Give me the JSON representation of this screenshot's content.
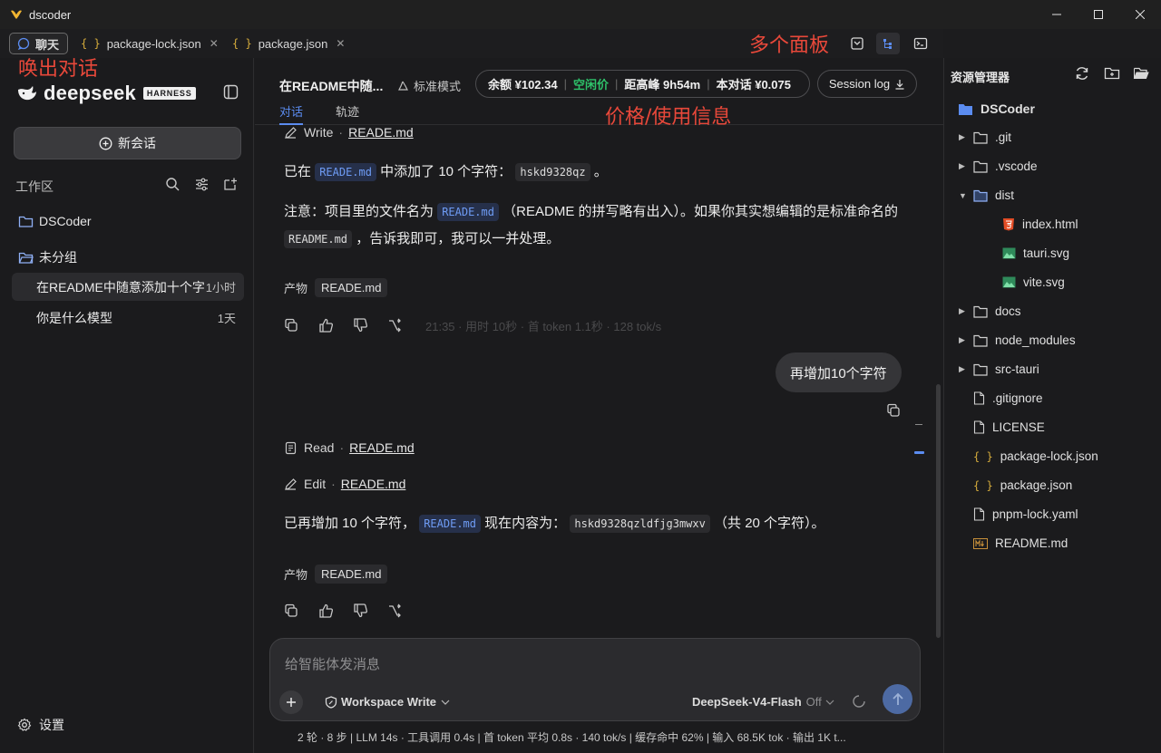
{
  "window": {
    "title": "dscoder"
  },
  "tabs": [
    {
      "label": "聊天"
    },
    {
      "label": "package-lock.json"
    },
    {
      "label": "package.json"
    }
  ],
  "annotations": {
    "summon_chat": "唤出对话",
    "multi_panel": "多个面板",
    "price_info": "价格/使用信息"
  },
  "sidebar": {
    "brand": "deepseek",
    "brand_badge": "HARNESS",
    "new_chat": "新会话",
    "workspace_label": "工作区",
    "groups": [
      {
        "label": "DSCoder"
      },
      {
        "label": "未分组"
      }
    ],
    "chats": [
      {
        "title": "在README中随意添加十个字",
        "time": "1小时"
      },
      {
        "title": "你是什么模型",
        "time": "1天"
      }
    ],
    "settings": "设置"
  },
  "header": {
    "title": "在README中随...",
    "mode": "标准模式",
    "price": {
      "balance": "余额 ¥102.34",
      "tier": "空闲价",
      "peak": "距高峰 9h54m",
      "conversation": "本对话 ¥0.075"
    },
    "session_log": "Session log",
    "tabs": {
      "chat": "对话",
      "track": "轨迹"
    }
  },
  "messages": {
    "m1": {
      "tool": {
        "action": "Write",
        "file": "READE.md"
      },
      "p1": {
        "a": "已在",
        "code1": "READE.md",
        "b": "中添加了 10 个字符：",
        "code2": "hskd9328qz",
        "c": "。"
      },
      "p2": {
        "a": "注意：项目里的文件名为",
        "code1": "READE.md",
        "b": "（README 的拼写略有出入）。如果你其实想编辑的是标准命名的",
        "code2": "README.md",
        "c": "，告诉我即可，我可以一并处理。"
      },
      "artifact_label": "产物",
      "artifact": "READE.md",
      "stats": "21:35  ·  用时 10秒  ·  首 token 1.1秒  ·  128 tok/s"
    },
    "user": "再增加10个字符",
    "m2": {
      "read": {
        "action": "Read",
        "file": "READE.md"
      },
      "edit": {
        "action": "Edit",
        "file": "READE.md"
      },
      "p1": {
        "a": "已再增加 10 个字符，",
        "code1": "READE.md",
        "b": "现在内容为：",
        "code2": "hskd9328qzldfjg3mwxv",
        "c": "（共 20 个字符）。"
      },
      "artifact_label": "产物",
      "artifact": "READE.md"
    }
  },
  "composer": {
    "placeholder": "给智能体发消息",
    "workspace_mode": "Workspace Write",
    "model": "DeepSeek-V4-Flash",
    "model_toggle": "Off"
  },
  "statusline": "2 轮 · 8 步   |   LLM 14s · 工具调用 0.4s   |   首 token 平均 0.8s · 140 tok/s   |   缓存命中 62%   |   输入 68.5K tok · 输出 1K t...",
  "explorer": {
    "title": "资源管理器",
    "root": "DSCoder",
    "items": [
      {
        "name": ".git",
        "kind": "folder"
      },
      {
        "name": ".vscode",
        "kind": "folder"
      },
      {
        "name": "dist",
        "kind": "folder-open"
      },
      {
        "name": "index.html",
        "kind": "html"
      },
      {
        "name": "tauri.svg",
        "kind": "image"
      },
      {
        "name": "vite.svg",
        "kind": "image"
      },
      {
        "name": "docs",
        "kind": "folder"
      },
      {
        "name": "node_modules",
        "kind": "folder"
      },
      {
        "name": "src-tauri",
        "kind": "folder"
      },
      {
        "name": ".gitignore",
        "kind": "file"
      },
      {
        "name": "LICENSE",
        "kind": "file"
      },
      {
        "name": "package-lock.json",
        "kind": "json"
      },
      {
        "name": "package.json",
        "kind": "json"
      },
      {
        "name": "pnpm-lock.yaml",
        "kind": "file"
      },
      {
        "name": "README.md",
        "kind": "markdown"
      }
    ]
  },
  "colors": {
    "accent": "#5b8cf0",
    "annotation": "#e8483a",
    "green": "#2ec26a",
    "send": "#4d6aa3"
  }
}
